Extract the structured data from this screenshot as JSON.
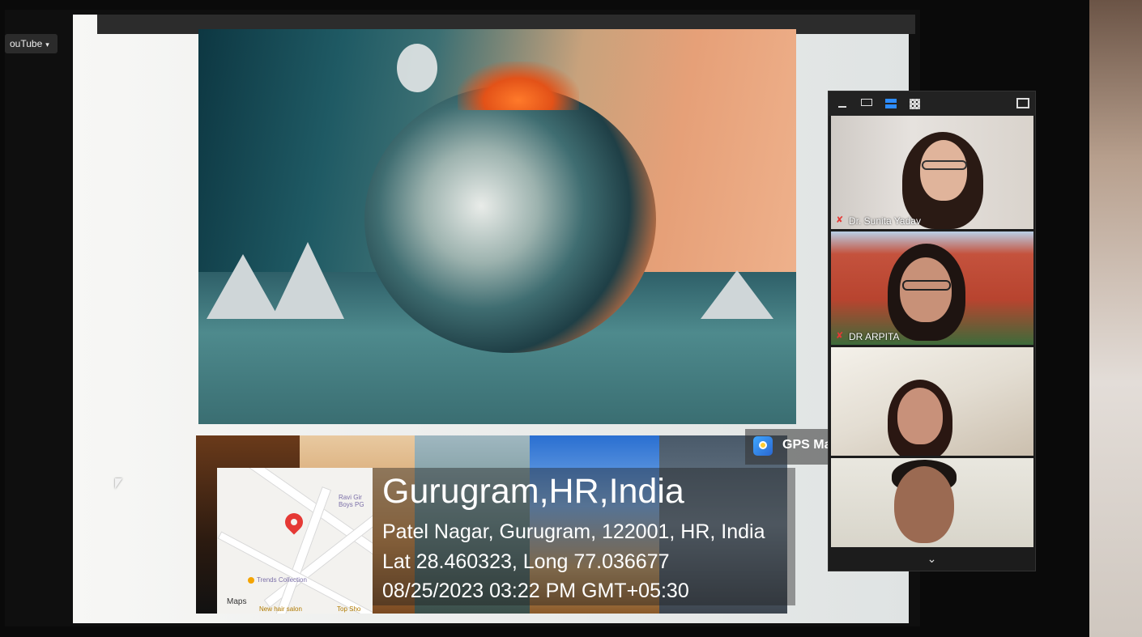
{
  "browser": {
    "youtube_menu_label": "ouTube",
    "caret": "▾"
  },
  "gps_overlay": {
    "app_name": "GPS Map Camera",
    "city": "Gurugram,HR,India",
    "address": "Patel Nagar, Gurugram, 122001, HR, India",
    "coordinates": "Lat 28.460323, Long 77.036677",
    "datetime": "08/25/2023 03:22 PM GMT+05:30",
    "map_pois": {
      "top": "Ravi Gir Boys PG",
      "left": "Trends Collection",
      "bottom_a": "New hair salon",
      "bottom_b": "Top Sho"
    },
    "map_brand": "Maps"
  },
  "meeting_panel": {
    "participants": [
      {
        "name": "Dr. Sunita Yadav",
        "muted": true
      },
      {
        "name": "DR ARPITA",
        "muted": true
      },
      {
        "name": "",
        "muted": false
      },
      {
        "name": "",
        "muted": false
      }
    ],
    "scroll_down": "⌄"
  },
  "colors": {
    "pin": "#e53935",
    "panel_bg": "#1c1c1c",
    "accent_blue": "#2d8cff"
  }
}
